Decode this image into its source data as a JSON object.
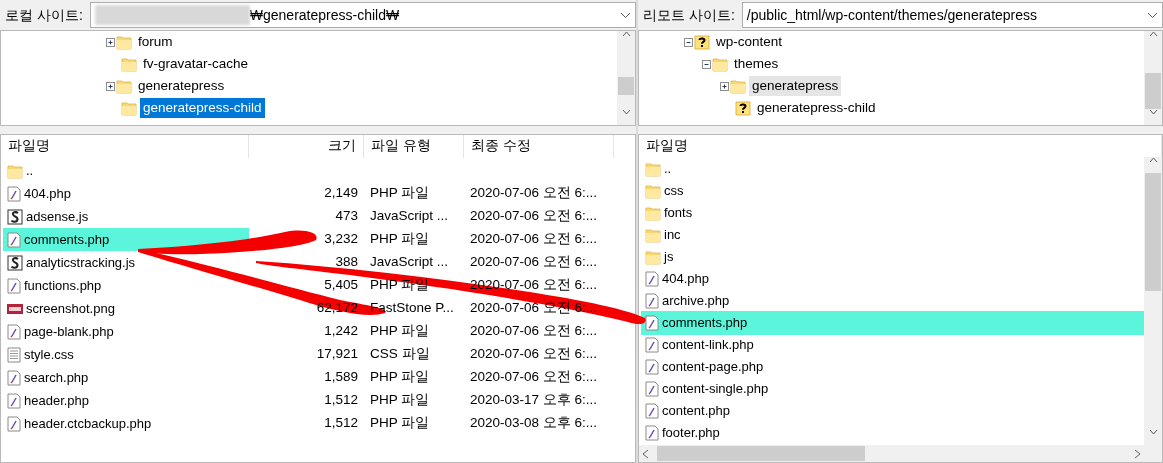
{
  "local": {
    "label": "로컬 사이트:",
    "path": "₩generatepress-child₩",
    "path_redacted": true,
    "tree": [
      {
        "label": "forum",
        "kind": "folder",
        "expandable": true,
        "expanded": false,
        "selected": false,
        "hovered": false
      },
      {
        "label": "fv-gravatar-cache",
        "kind": "folder",
        "expandable": false,
        "selected": false,
        "hovered": false
      },
      {
        "label": "generatepress",
        "kind": "folder",
        "expandable": true,
        "expanded": false,
        "selected": false,
        "hovered": false
      },
      {
        "label": "generatepress-child",
        "kind": "folder",
        "expandable": false,
        "selected": true,
        "hovered": false
      }
    ],
    "columns": [
      "파일명",
      "크기",
      "파일 유형",
      "최종 수정"
    ],
    "files": [
      {
        "name": "..",
        "kind": "folder",
        "highlighted": false
      },
      {
        "name": "404.php",
        "kind": "php",
        "size": "2,149",
        "type": "PHP 파일",
        "modified": "2020-07-06 오전 6:...",
        "highlighted": false
      },
      {
        "name": "adsense.js",
        "kind": "js",
        "size": "473",
        "type": "JavaScript ...",
        "modified": "2020-07-06 오전 6:...",
        "highlighted": false
      },
      {
        "name": "comments.php",
        "kind": "php",
        "size": "3,232",
        "type": "PHP 파일",
        "modified": "2020-07-06 오전 6:...",
        "highlighted": true
      },
      {
        "name": "analyticstracking.js",
        "kind": "js",
        "size": "388",
        "type": "JavaScript ...",
        "modified": "2020-07-06 오전 6:...",
        "highlighted": false
      },
      {
        "name": "functions.php",
        "kind": "php",
        "size": "5,405",
        "type": "PHP 파일",
        "modified": "2020-07-06 오전 6:...",
        "highlighted": false
      },
      {
        "name": "screenshot.png",
        "kind": "png",
        "size": "62,172",
        "type": "FastStone P...",
        "modified": "2020-07-06 오전 6:...",
        "highlighted": false
      },
      {
        "name": "page-blank.php",
        "kind": "php",
        "size": "1,242",
        "type": "PHP 파일",
        "modified": "2020-07-06 오전 6:...",
        "highlighted": false
      },
      {
        "name": "style.css",
        "kind": "css",
        "size": "17,921",
        "type": "CSS 파일",
        "modified": "2020-07-06 오전 6:...",
        "highlighted": false
      },
      {
        "name": "search.php",
        "kind": "php",
        "size": "1,589",
        "type": "PHP 파일",
        "modified": "2020-07-06 오전 6:...",
        "highlighted": false
      },
      {
        "name": "header.php",
        "kind": "php",
        "size": "1,512",
        "type": "PHP 파일",
        "modified": "2020-03-17 오후 6:...",
        "highlighted": false
      },
      {
        "name": "header.ctcbackup.php",
        "kind": "php",
        "size": "1,512",
        "type": "PHP 파일",
        "modified": "2020-03-08 오후 6:...",
        "highlighted": false
      }
    ]
  },
  "remote": {
    "label": "리모트 사이트:",
    "path": "/public_html/wp-content/themes/generatepress",
    "tree": [
      {
        "label": "wp-content",
        "kind": "unknown",
        "expandable": true,
        "expanded": true,
        "selected": false,
        "hovered": false,
        "children": [
          {
            "label": "themes",
            "kind": "folder",
            "expandable": true,
            "expanded": true,
            "selected": false,
            "hovered": false,
            "children": [
              {
                "label": "generatepress",
                "kind": "folder",
                "expandable": true,
                "expanded": false,
                "selected": false,
                "hovered": true
              },
              {
                "label": "generatepress-child",
                "kind": "unknown",
                "expandable": false,
                "selected": false,
                "hovered": false
              }
            ]
          }
        ]
      }
    ],
    "columns": [
      "파일명"
    ],
    "files": [
      {
        "name": "..",
        "kind": "folder",
        "highlighted": false
      },
      {
        "name": "css",
        "kind": "folder",
        "highlighted": false
      },
      {
        "name": "fonts",
        "kind": "folder",
        "highlighted": false
      },
      {
        "name": "inc",
        "kind": "folder",
        "highlighted": false
      },
      {
        "name": "js",
        "kind": "folder",
        "highlighted": false
      },
      {
        "name": "404.php",
        "kind": "php",
        "highlighted": false
      },
      {
        "name": "archive.php",
        "kind": "php",
        "highlighted": false
      },
      {
        "name": "comments.php",
        "kind": "php",
        "highlighted": true
      },
      {
        "name": "content-link.php",
        "kind": "php",
        "highlighted": false
      },
      {
        "name": "content-page.php",
        "kind": "php",
        "highlighted": false
      },
      {
        "name": "content-single.php",
        "kind": "php",
        "highlighted": false
      },
      {
        "name": "content.php",
        "kind": "php",
        "highlighted": false
      },
      {
        "name": "footer.php",
        "kind": "php",
        "highlighted": false
      }
    ]
  }
}
